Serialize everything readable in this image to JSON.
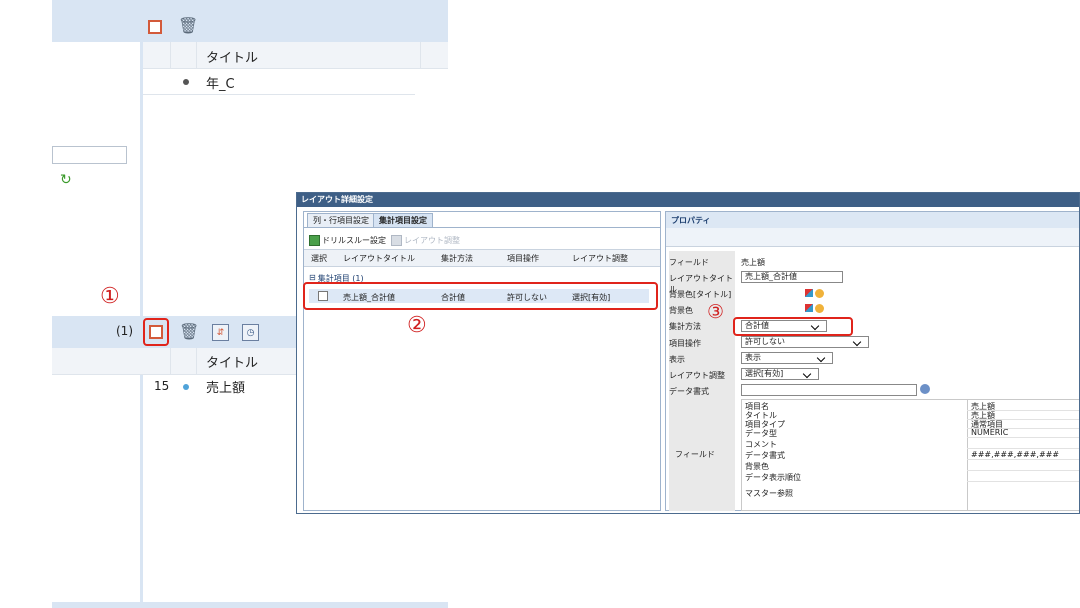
{
  "top_panel": {
    "col_title": "タイトル",
    "row_value": "年_C"
  },
  "bottom_panel": {
    "count_badge": "(1)",
    "col_title": "タイトル",
    "row_num": "15",
    "row_value": "売上額"
  },
  "annotations": {
    "n1": "①",
    "n2": "②",
    "n3": "③"
  },
  "dialog": {
    "title": "レイアウト詳細設定",
    "tabs": [
      "列・行項目設定",
      "集計項目設定"
    ],
    "toolbar": {
      "drill": "ドリルスルー設定",
      "layout": "レイアウト調整"
    },
    "table": {
      "headers": [
        "選択",
        "レイアウトタイトル",
        "集計方法",
        "項目操作",
        "レイアウト調整"
      ],
      "group_label": "集計項目 (1)",
      "row": {
        "title": "売上額_合計値",
        "method": "合計値",
        "operation": "許可しない",
        "adjust": "選択[有効]"
      }
    },
    "properties": {
      "header": "プロパティ",
      "rows": [
        {
          "label": "フィールド",
          "value": "売上額"
        },
        {
          "label": "レイアウトタイトル",
          "value": "売上額_合計値"
        },
        {
          "label": "背景色[タイトル]",
          "value": ""
        },
        {
          "label": "背景色",
          "value": ""
        },
        {
          "label": "集計方法",
          "value": "合計値"
        },
        {
          "label": "項目操作",
          "value": "許可しない"
        },
        {
          "label": "表示",
          "value": "表示"
        },
        {
          "label": "レイアウト調整",
          "value": "選択[有効]"
        },
        {
          "label": "データ書式",
          "value": ""
        }
      ],
      "field_label": "フィールド",
      "field_table": [
        {
          "k": "項目名",
          "v": "売上額"
        },
        {
          "k": "タイトル",
          "v": "売上額"
        },
        {
          "k": "項目タイプ",
          "v": "通常項目"
        },
        {
          "k": "データ型",
          "v": "NUMERIC"
        },
        {
          "k": "コメント",
          "v": ""
        },
        {
          "k": "データ書式",
          "v": "###,###,###,###"
        },
        {
          "k": "背景色",
          "v": ""
        },
        {
          "k": "データ表示順位",
          "v": ""
        },
        {
          "k": "マスター参照",
          "v": ""
        }
      ]
    }
  }
}
